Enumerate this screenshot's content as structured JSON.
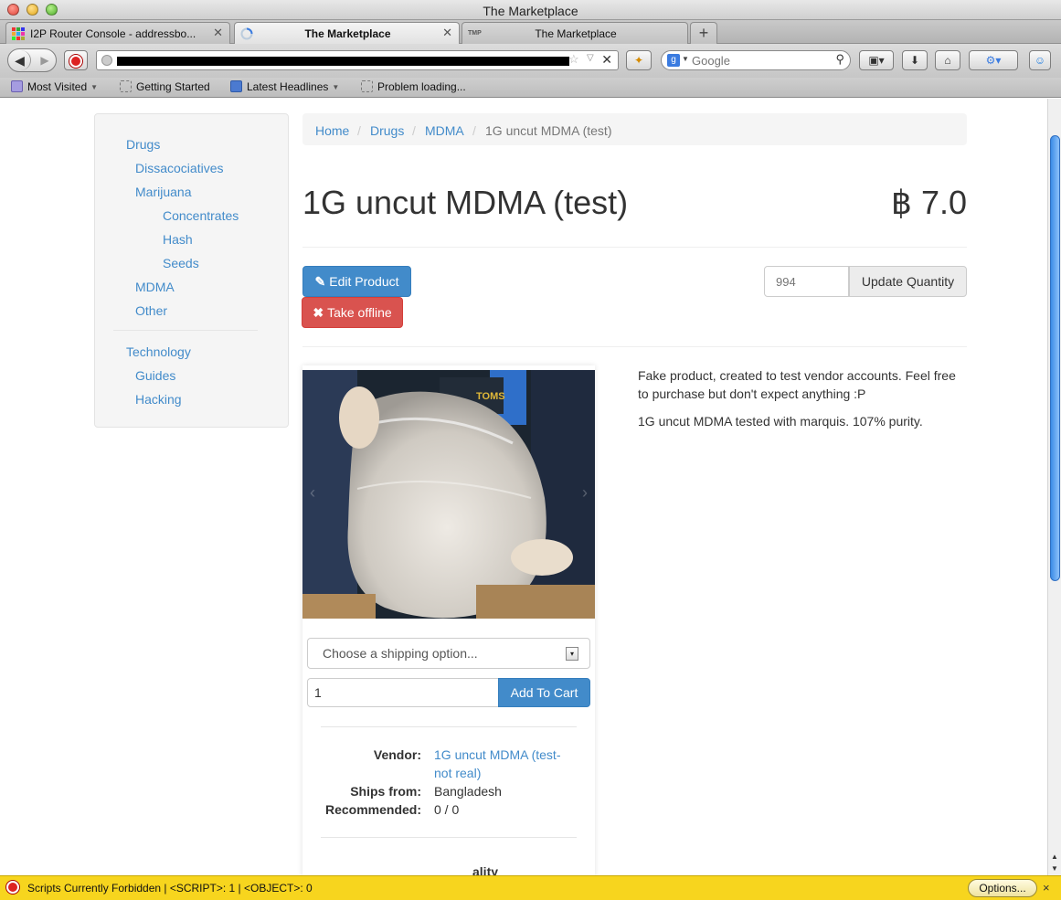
{
  "window": {
    "title": "The Marketplace"
  },
  "tabs": [
    {
      "label": "I2P Router Console - addressbo...",
      "active": false
    },
    {
      "label": "The Marketplace",
      "active": true
    },
    {
      "label": "The Marketplace",
      "active": false
    }
  ],
  "toolbar": {
    "search_placeholder": "Google",
    "search_engine": "g"
  },
  "bookmarks": [
    {
      "label": "Most Visited",
      "icon": "folder-icon",
      "has_dropdown": true
    },
    {
      "label": "Getting Started",
      "icon": "page-icon",
      "has_dropdown": false
    },
    {
      "label": "Latest Headlines",
      "icon": "rss-icon",
      "has_dropdown": true
    },
    {
      "label": "Problem loading...",
      "icon": "page-icon",
      "has_dropdown": false
    }
  ],
  "sidebar": {
    "items": [
      {
        "label": "Drugs",
        "level": 0
      },
      {
        "label": "Dissacociatives",
        "level": 1
      },
      {
        "label": "Marijuana",
        "level": 1
      },
      {
        "label": "Concentrates",
        "level": 2
      },
      {
        "label": "Hash",
        "level": 2
      },
      {
        "label": "Seeds",
        "level": 2
      },
      {
        "label": "MDMA",
        "level": 1
      },
      {
        "label": "Other",
        "level": 1
      },
      {
        "label": "Technology",
        "level": 0
      },
      {
        "label": "Guides",
        "level": 1
      },
      {
        "label": "Hacking",
        "level": 1
      }
    ]
  },
  "breadcrumb": {
    "items": [
      "Home",
      "Drugs",
      "MDMA"
    ],
    "current": "1G uncut MDMA (test)",
    "separator": "/"
  },
  "product": {
    "title": "1G uncut MDMA (test)",
    "price": "฿ 7.0",
    "edit_label": "Edit Product",
    "offline_label": "Take offline",
    "quantity_placeholder": "994",
    "update_quantity_label": "Update Quantity",
    "shipping_placeholder": "Choose a shipping option...",
    "cart_quantity": "1",
    "add_to_cart_label": "Add To Cart",
    "description": [
      "Fake product, created to test vendor accounts. Feel free to purchase but don't expect anything :P",
      "1G uncut MDMA tested with marquis. 107% purity."
    ],
    "info": {
      "vendor_label": "Vendor:",
      "vendor_line1": "1G uncut MDMA (test-",
      "vendor_line2": "not real)",
      "ships_from_label": "Ships from:",
      "ships_from": "Bangladesh",
      "recommended_label": "Recommended:",
      "recommended": "0 / 0"
    },
    "cut_heading": "ality"
  },
  "statusbar": {
    "text": "Scripts Currently Forbidden | <SCRIPT>: 1 | <OBJECT>: 0",
    "options_label": "Options...",
    "close": "×"
  },
  "colors": {
    "link": "#428bca",
    "primary": "#428bca",
    "danger": "#d9534f",
    "statusbar": "#f7d51e"
  }
}
